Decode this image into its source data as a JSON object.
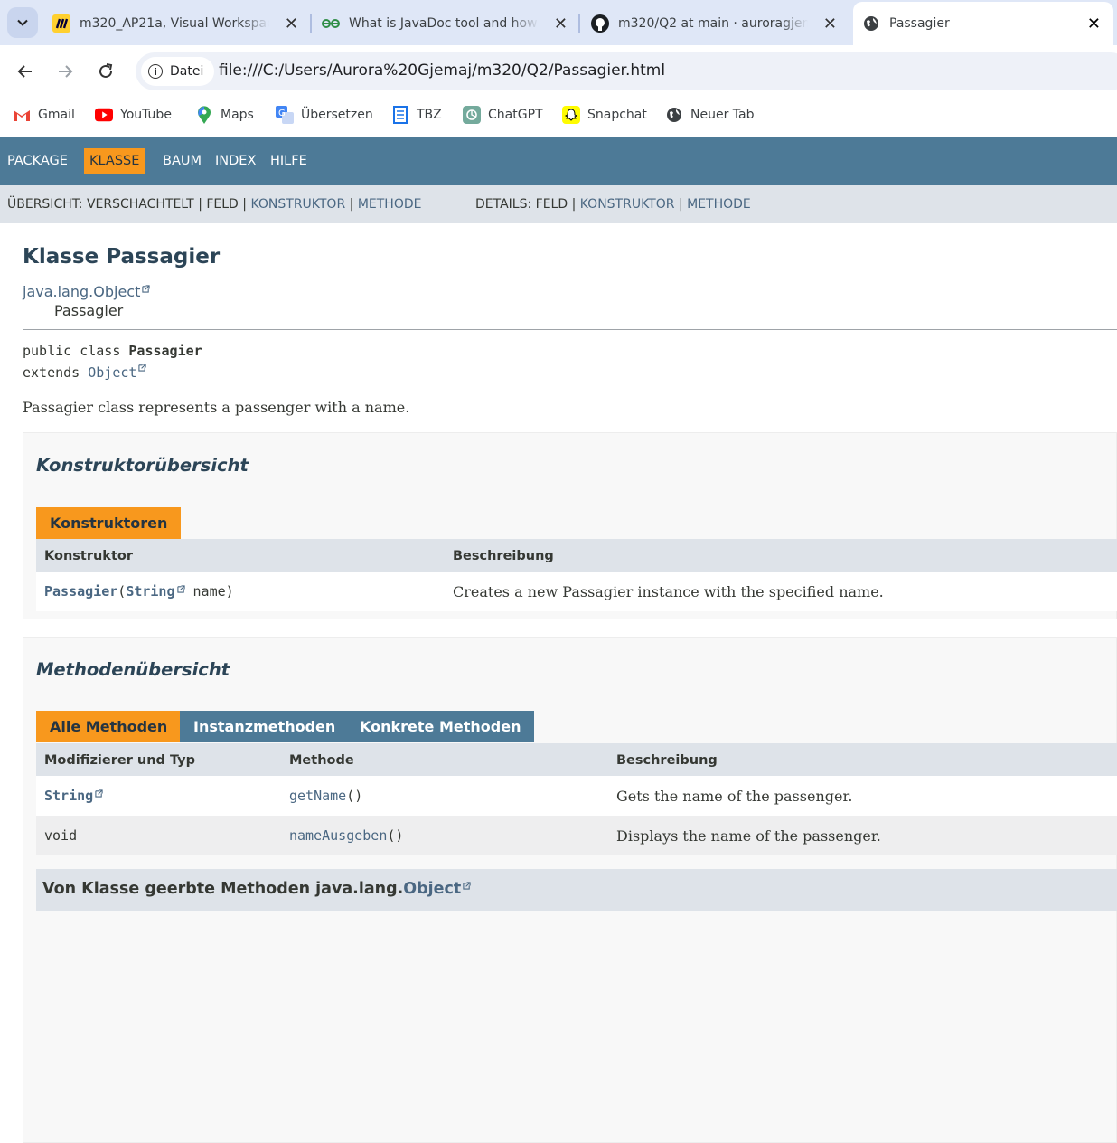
{
  "browser": {
    "tabs": [
      {
        "title": "m320_AP21a, Visual Workspace",
        "icon": "miro-icon"
      },
      {
        "title": "What is JavaDoc tool and how to use it",
        "icon": "geeksforgeeks-icon"
      },
      {
        "title": "m320/Q2 at main · auroragjemaj/m320",
        "icon": "github-icon"
      },
      {
        "title": "Passagier",
        "icon": "globe-icon",
        "active": true
      }
    ],
    "close_glyph": "✕",
    "security_chip": "Datei",
    "url": "file:///C:/Users/Aurora%20Gjemaj/m320/Q2/Passagier.html",
    "bookmarks": [
      {
        "label": "Gmail",
        "icon": "gmail-icon"
      },
      {
        "label": "YouTube",
        "icon": "youtube-icon"
      },
      {
        "label": "Maps",
        "icon": "maps-icon"
      },
      {
        "label": "Übersetzen",
        "icon": "translate-icon"
      },
      {
        "label": "TBZ",
        "icon": "document-icon"
      },
      {
        "label": "ChatGPT",
        "icon": "chatgpt-icon"
      },
      {
        "label": "Snapchat",
        "icon": "snapchat-icon"
      },
      {
        "label": "Neuer Tab",
        "icon": "globe-icon"
      }
    ]
  },
  "javadoc": {
    "topnav": [
      "PACKAGE",
      "KLASSE",
      "BAUM",
      "INDEX",
      "HILFE"
    ],
    "topnav_active": "KLASSE",
    "subnav": {
      "summary_label": "ÜBERSICHT:",
      "summary_nested": "VERSCHACHTELT",
      "summary_field": "FELD",
      "summary_constructor": "KONSTRUKTOR",
      "summary_method": "METHODE",
      "detail_label": "DETAILS:",
      "detail_field": "FELD",
      "detail_constructor": "KONSTRUKTOR",
      "detail_method": "METHODE",
      "sep": "|"
    },
    "title": "Klasse Passagier",
    "inheritance": [
      "java.lang.Object",
      "Passagier"
    ],
    "signature": {
      "modifiers": "public class ",
      "name": "Passagier",
      "extends_kw": "extends ",
      "superclass": "Object"
    },
    "description": "Passagier class represents a passenger with a name.",
    "constructor_summary": {
      "heading": "Konstruktorübersicht",
      "caption": "Konstruktoren",
      "headers": [
        "Konstruktor",
        "Beschreibung"
      ],
      "rows": [
        {
          "name": "Passagier",
          "open": "(",
          "param_type": "String",
          "param_name": " name)",
          "description": "Creates a new Passagier instance with the specified name."
        }
      ]
    },
    "method_summary": {
      "heading": "Methodenübersicht",
      "tabs": [
        "Alle Methoden",
        "Instanzmethoden",
        "Konkrete Methoden"
      ],
      "headers": [
        "Modifizierer und Typ",
        "Methode",
        "Beschreibung"
      ],
      "rows": [
        {
          "type": "String",
          "type_is_link": true,
          "method": "getName",
          "parens": "()",
          "description": "Gets the name of the passenger."
        },
        {
          "type": "void",
          "type_is_link": false,
          "method": "nameAusgeben",
          "parens": "()",
          "description": "Displays the name of the passenger."
        }
      ],
      "inherited_prefix": "Von Klasse geerbte Methoden java.lang.",
      "inherited_class": "Object"
    }
  }
}
